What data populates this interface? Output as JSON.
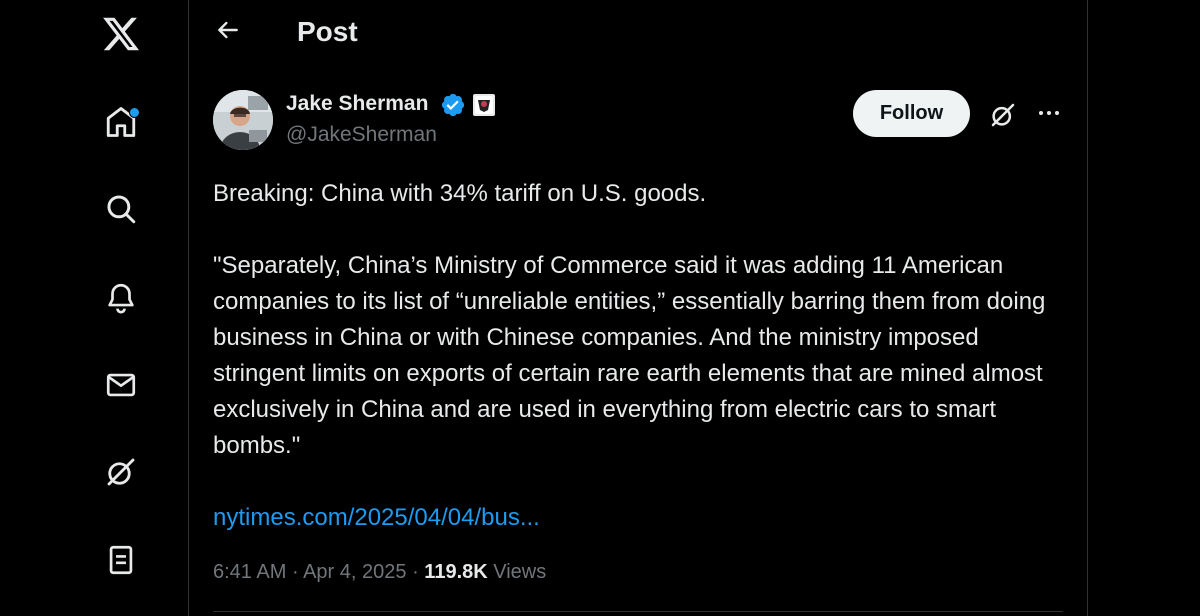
{
  "nav": {
    "items": [
      {
        "icon": "x-logo-icon"
      },
      {
        "icon": "home-icon",
        "has_notification_dot": true
      },
      {
        "icon": "search-icon"
      },
      {
        "icon": "bell-icon"
      },
      {
        "icon": "mail-icon"
      },
      {
        "icon": "grok-icon"
      },
      {
        "icon": "lists-icon"
      }
    ],
    "accent_color": "#1d9bf0"
  },
  "header": {
    "title": "Post",
    "back_icon": "arrow-left-icon"
  },
  "post": {
    "author": {
      "name": "Jake Sherman",
      "handle": "@JakeSherman",
      "verified": true,
      "verified_color": "#1d9bf0"
    },
    "follow_label": "Follow",
    "paragraphs": [
      "Breaking: China with 34% tariff on U.S. goods.",
      "\"Separately, China’s Ministry of Commerce said it was adding 11 American companies to its list of “unreliable entities,” essentially barring them from doing business in China or with Chinese companies. And the ministry imposed stringent limits on exports of certain rare earth elements that are mined almost exclusively in China and are used in everything from electric cars to smart bombs.\""
    ],
    "link_text": "nytimes.com/2025/04/04/bus...",
    "link_color": "#1d9bf0",
    "time": "6:41 AM",
    "separator": "·",
    "date": "Apr 4, 2025",
    "views_count": "119.8K",
    "views_label": "Views"
  }
}
